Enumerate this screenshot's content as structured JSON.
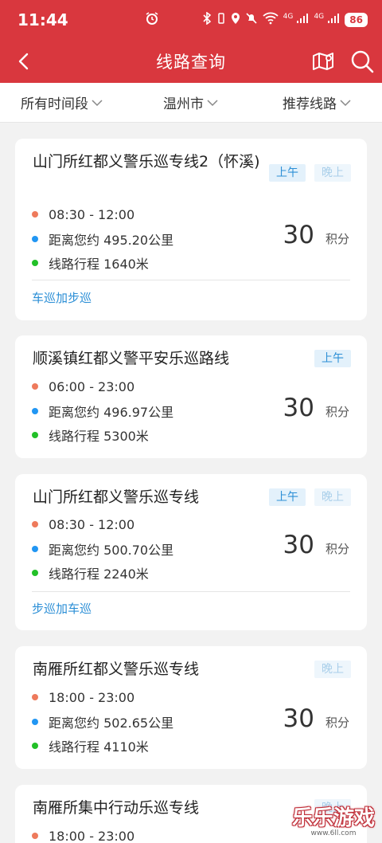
{
  "status_bar": {
    "time": "11:44",
    "battery": "86",
    "network_1": "4G",
    "network_2": "4G"
  },
  "header": {
    "title": "线路查询"
  },
  "filters": [
    {
      "label": "所有时间段"
    },
    {
      "label": "温州市"
    },
    {
      "label": "推荐线路"
    }
  ],
  "routes": [
    {
      "name": "山门所红都义警乐巡专线2（怀溪)",
      "tags": [
        "上午",
        "晚上"
      ],
      "time": "08:30 - 12:00",
      "distance": "距离您约 495.20公里",
      "length": "线路行程 1640米",
      "points": "30",
      "points_unit": "积分",
      "mode": "车巡加步巡"
    },
    {
      "name": "顺溪镇红都义警平安乐巡路线",
      "tags": [
        "上午"
      ],
      "time": "06:00 - 23:00",
      "distance": "距离您约 496.97公里",
      "length": "线路行程 5300米",
      "points": "30",
      "points_unit": "积分"
    },
    {
      "name": "山门所红都义警乐巡专线",
      "tags": [
        "上午",
        "晚上"
      ],
      "time": "08:30 - 12:00",
      "distance": "距离您约 500.70公里",
      "length": "线路行程 2240米",
      "points": "30",
      "points_unit": "积分",
      "mode": "步巡加车巡"
    },
    {
      "name": "南雁所红都义警乐巡专线",
      "tags": [
        "晚上"
      ],
      "time": "18:00 - 23:00",
      "distance": "距离您约 502.65公里",
      "length": "线路行程 4110米",
      "points": "30",
      "points_unit": "积分"
    },
    {
      "name": "南雁所集中行动乐巡专线",
      "tags": [
        "晚上"
      ],
      "time": "18:00 - 23:00"
    }
  ],
  "watermark": {
    "text": "乐乐游戏",
    "url": "www.6ll.com"
  },
  "colors": {
    "brand_red": "#d9373e",
    "accent_blue": "#2c8fd6",
    "dot_orange": "#ee7a5c",
    "dot_blue": "#2196f3",
    "dot_green": "#22c028"
  }
}
